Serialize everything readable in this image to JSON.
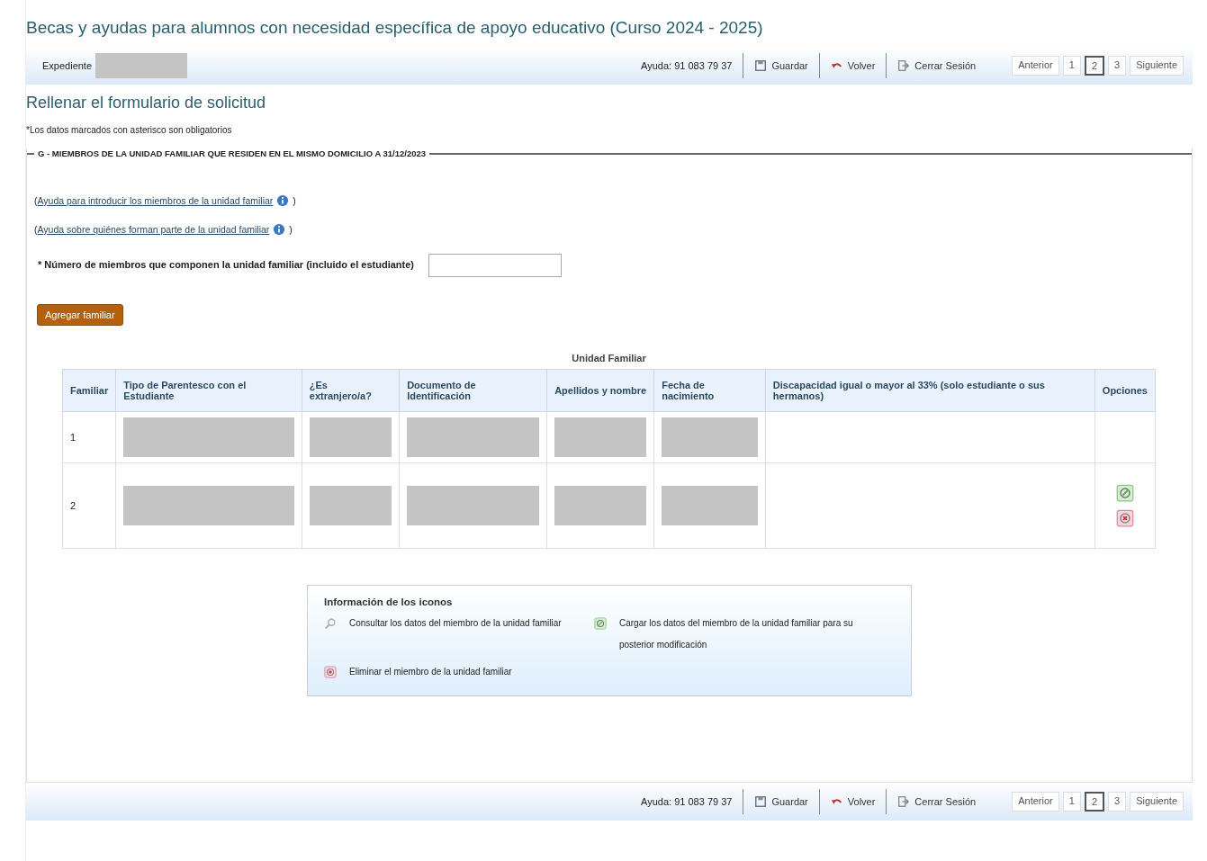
{
  "title": "Becas y ayudas para alumnos con necesidad específica de apoyo educativo (Curso 2024 - 2025)",
  "top_bar": {
    "expediente_label": "Expediente",
    "expediente_redacted": true,
    "help": "Ayuda: 91 083 79 37",
    "actions": [
      {
        "kind": "save",
        "label": "Guardar"
      },
      {
        "kind": "back",
        "label": "Volver"
      },
      {
        "kind": "logout",
        "label": "Cerrar Sesión"
      }
    ],
    "pager": [
      {
        "label": "Anterior",
        "selected": false
      },
      {
        "label": "1",
        "selected": false
      },
      {
        "label": "2",
        "selected": true
      },
      {
        "label": "3",
        "selected": false
      },
      {
        "label": "Siguiente",
        "selected": false
      }
    ]
  },
  "heading": "Rellenar el formulario de solicitud",
  "required_note": "*Los datos marcados con asterisco son obligatorios",
  "section": {
    "legend": "G - MIEMBROS DE LA UNIDAD FAMILIAR QUE RESIDEN EN EL MISMO DOMICILIO A 31/12/2023",
    "help_links": [
      {
        "open": "(",
        "link": "Ayuda para introducir los miembros de la unidad familiar",
        "close": ")"
      },
      {
        "open": "(",
        "link": "Ayuda sobre quiénes forman parte de la unidad familiar",
        "close": ")"
      }
    ],
    "members_field": {
      "label": "* Número de miembros que componen la unidad familiar (incluido el estudiante)"
    },
    "add_button": "Agregar familiar",
    "table": {
      "caption": "Unidad Familiar",
      "columns": [
        "Familiar",
        "Tipo de Parentesco con el Estudiante",
        "¿Es extranjero/a?",
        "Documento de Identificación",
        "Apellidos y nombre",
        "Fecha de nacimiento",
        "Discapacidad igual o mayor al 33% (solo estudiante o sus hermanos)",
        "Opciones"
      ],
      "rows": [
        {
          "familiar": "1",
          "cells": [
            {
              "kind": "redacted"
            },
            {
              "kind": "redacted"
            },
            {
              "kind": "redacted"
            },
            {
              "kind": "redacted"
            },
            {
              "kind": "redacted"
            },
            {
              "kind": "blank"
            }
          ],
          "options": []
        },
        {
          "familiar": "2",
          "cells": [
            {
              "kind": "redacted"
            },
            {
              "kind": "redacted"
            },
            {
              "kind": "redacted"
            },
            {
              "kind": "redacted"
            },
            {
              "kind": "redacted"
            },
            {
              "kind": "blank"
            }
          ],
          "options": [
            {
              "kind": "edit"
            },
            {
              "kind": "delete"
            }
          ]
        }
      ]
    },
    "icon_info": {
      "title": "Información de los iconos",
      "items": [
        {
          "kind": "view",
          "text": "Consultar los datos del miembro de la unidad familiar"
        },
        {
          "kind": "edit",
          "text": "Cargar los datos del miembro de la unidad familiar para su posterior modificación"
        },
        {
          "kind": "delete",
          "text": "Eliminar el miembro de la unidad familiar"
        }
      ]
    }
  },
  "bottom_bar": {
    "help": "Ayuda: 91 083 79 37",
    "actions": [
      {
        "kind": "save",
        "label": "Guardar"
      },
      {
        "kind": "back",
        "label": "Volver"
      },
      {
        "kind": "logout",
        "label": "Cerrar Sesión"
      }
    ],
    "pager": [
      {
        "label": "Anterior",
        "selected": false
      },
      {
        "label": "1",
        "selected": false
      },
      {
        "label": "2",
        "selected": true
      },
      {
        "label": "3",
        "selected": false
      },
      {
        "label": "Siguiente",
        "selected": false
      }
    ]
  }
}
